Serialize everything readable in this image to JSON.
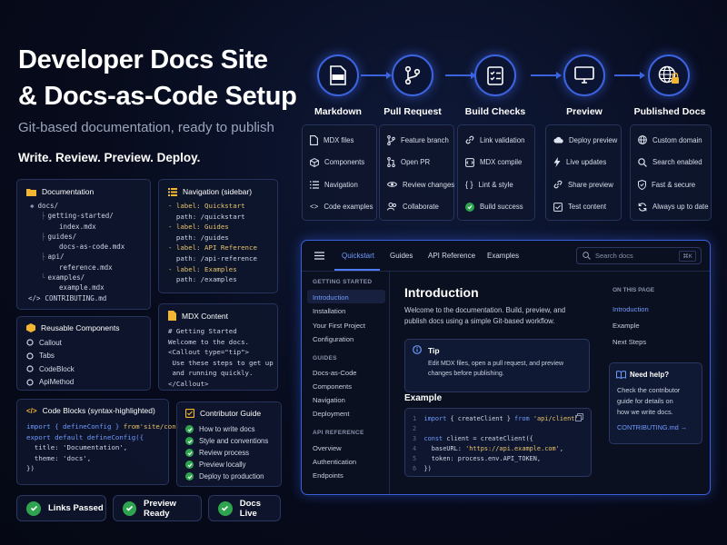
{
  "header": {
    "title_line1": "Developer Docs Site",
    "title_line2": "& Docs-as-Code Setup",
    "subtitle": "Git-based documentation, ready to publish",
    "tagline": "Write. Review. Preview. Deploy."
  },
  "documentation": {
    "title": "Documentation",
    "tree": [
      "docs/",
      "getting-started/",
      "index.mdx",
      "guides/",
      "docs-as-code.mdx",
      "api/",
      "reference.mdx",
      "examples/",
      "example.mdx",
      "CONTRIBUTING.md"
    ]
  },
  "navigation": {
    "title": "Navigation (sidebar)",
    "lines": [
      "- label: Quickstart",
      "  path: /quickstart",
      "- label: Guides",
      "  path: /guides",
      "- label: API Reference",
      "  path: /api-reference",
      "- label: Examples",
      "  path: /examples"
    ]
  },
  "components": {
    "title": "Reusable Components",
    "items": [
      "Callout",
      "Tabs",
      "CodeBlock",
      "ApiMethod"
    ]
  },
  "mdx": {
    "title": "MDX Content",
    "lines": [
      "# Getting Started",
      "Welcome to the docs.",
      "<Callout type=\"tip\">",
      " Use these steps to get up",
      " and running quickly.",
      "</Callout>"
    ]
  },
  "codeblocks": {
    "title": "Code Blocks (syntax-highlighted)",
    "lines": [
      [
        "import { defineConfig } ",
        "from'site/config'"
      ],
      [
        "export default defineConfig({",
        ""
      ],
      [
        "  title: 'Documentation',",
        ""
      ],
      [
        "  theme: 'docs',",
        ""
      ],
      [
        "})",
        ""
      ]
    ]
  },
  "contributor": {
    "title": "Contributor Guide",
    "items": [
      "How to write docs",
      "Style and conventions",
      "Review process",
      "Preview locally",
      "Deploy to production"
    ]
  },
  "status_pills": [
    "Links Passed",
    "Preview Ready",
    "Docs Live"
  ],
  "pipeline": [
    {
      "label": "Markdown",
      "icon": "mdx-file-icon",
      "icon_text": "MDX",
      "items": [
        [
          "MDX files",
          "document-icon"
        ],
        [
          "Components",
          "cube-icon"
        ],
        [
          "Navigation",
          "list-icon"
        ],
        [
          "Code examples",
          "code-icon"
        ]
      ]
    },
    {
      "label": "Pull Request",
      "icon": "branch-icon",
      "items": [
        [
          "Feature branch",
          "branch-icon"
        ],
        [
          "Open PR",
          "pull-request-icon"
        ],
        [
          "Review changes",
          "eye-icon"
        ],
        [
          "Collaborate",
          "users-icon"
        ]
      ]
    },
    {
      "label": "Build Checks",
      "icon": "checklist-icon",
      "items": [
        [
          "Link validation",
          "link-icon"
        ],
        [
          "MDX compile",
          "compile-icon"
        ],
        [
          "Lint & style",
          "braces-icon"
        ],
        [
          "Build success",
          "check-icon"
        ]
      ]
    },
    {
      "label": "Preview",
      "icon": "monitor-icon",
      "items": [
        [
          "Deploy preview",
          "cloud-icon"
        ],
        [
          "Live updates",
          "bolt-icon"
        ],
        [
          "Share preview",
          "link-icon"
        ],
        [
          "Test content",
          "checkbox-icon"
        ]
      ]
    },
    {
      "label": "Published Docs",
      "icon": "globe-lock-icon",
      "items": [
        [
          "Custom domain",
          "globe-icon"
        ],
        [
          "Search enabled",
          "search-icon"
        ],
        [
          "Fast & secure",
          "shield-icon"
        ],
        [
          "Always up to date",
          "refresh-icon"
        ]
      ]
    }
  ],
  "app": {
    "tabs": [
      "Quickstart",
      "Guides",
      "API Reference",
      "Examples"
    ],
    "search_placeholder": "Search docs",
    "search_shortcut": "⌘K",
    "sidebar": {
      "getting_started_head": "GETTING STARTED",
      "getting_started": [
        "Introduction",
        "Installation",
        "Your First Project",
        "Configuration"
      ],
      "guides_head": "GUIDES",
      "guides": [
        "Docs-as-Code",
        "Components",
        "Navigation",
        "Deployment"
      ],
      "api_head": "API REFERENCE",
      "api": [
        "Overview",
        "Authentication",
        "Endpoints"
      ]
    },
    "main": {
      "title": "Introduction",
      "intro_line1": "Welcome to the documentation. Build, preview, and",
      "intro_line2": "publish docs using a simple Git-based workflow.",
      "tip_title": "Tip",
      "tip_line1": "Edit MDX files, open a pull request, and preview",
      "tip_line2": "changes before publishing.",
      "example_title": "Example"
    },
    "on_this_page": {
      "head": "ON THIS PAGE",
      "items": [
        "Introduction",
        "Example",
        "Next Steps"
      ]
    },
    "help": {
      "title": "Need help?",
      "line1": "Check the contributor",
      "line2": "guide for details on",
      "line3": "how we write docs.",
      "link": "CONTRIBUTING.md →"
    }
  },
  "colors": {
    "accent": "#4d7bff",
    "success": "#2ea44f",
    "folder": "#f2b632"
  }
}
